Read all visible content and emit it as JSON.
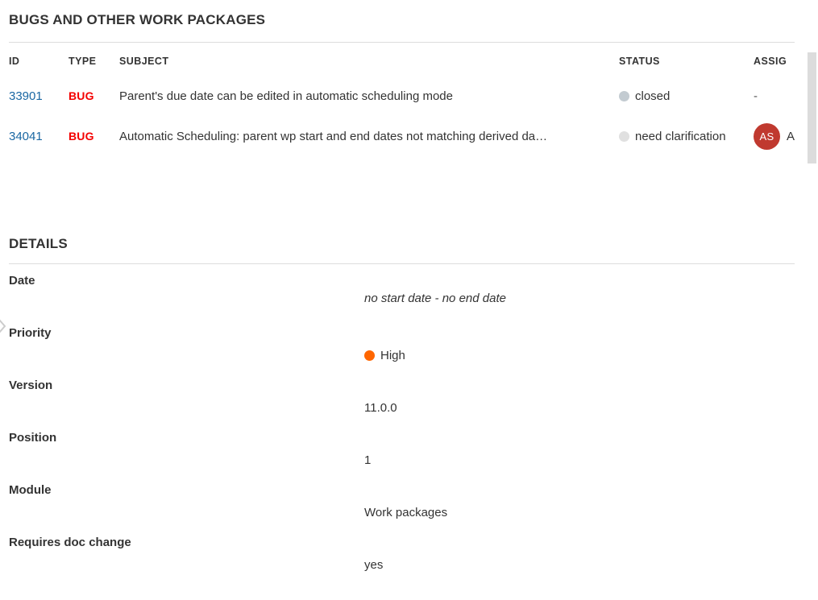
{
  "bugs_section": {
    "title": "BUGS AND OTHER WORK PACKAGES",
    "columns": {
      "id": "ID",
      "type": "TYPE",
      "subject": "SUBJECT",
      "status": "STATUS",
      "assignee": "ASSIG"
    },
    "rows": [
      {
        "id": "33901",
        "type": "BUG",
        "subject": "Parent's due date can be edited in automatic scheduling mode",
        "status": "closed",
        "status_color": "#c3cbd1",
        "assignee": "-",
        "assignee_initials": "",
        "assignee_trailing": ""
      },
      {
        "id": "34041",
        "type": "BUG",
        "subject": "Automatic Scheduling: parent wp start and end dates not matching derived da…",
        "status": "need clarification",
        "status_color": "#e0e0e0",
        "assignee": "",
        "assignee_initials": "AS",
        "assignee_trailing": "A"
      }
    ]
  },
  "details_section": {
    "title": "DETAILS",
    "rows": [
      {
        "label": "Date",
        "value": "no start date - no end date",
        "style": "italic"
      },
      {
        "label": "Priority",
        "value": "High",
        "style": "dot",
        "dot_color": "#ff6600"
      },
      {
        "label": "Version",
        "value": "11.0.0",
        "style": "plain"
      },
      {
        "label": "Position",
        "value": "1",
        "style": "plain"
      },
      {
        "label": "Module",
        "value": "Work packages",
        "style": "plain"
      },
      {
        "label": "Requires doc change",
        "value": "yes",
        "style": "plain"
      }
    ]
  },
  "icons": {
    "collapse_handle": "chevron-right-icon"
  },
  "colors": {
    "link": "#1a67a3",
    "type_bug": "#f40000",
    "avatar_bg": "#c0392f",
    "priority_high": "#ff6600",
    "divider": "#dddddd",
    "scrollbar_thumb": "#dcdcdc"
  }
}
